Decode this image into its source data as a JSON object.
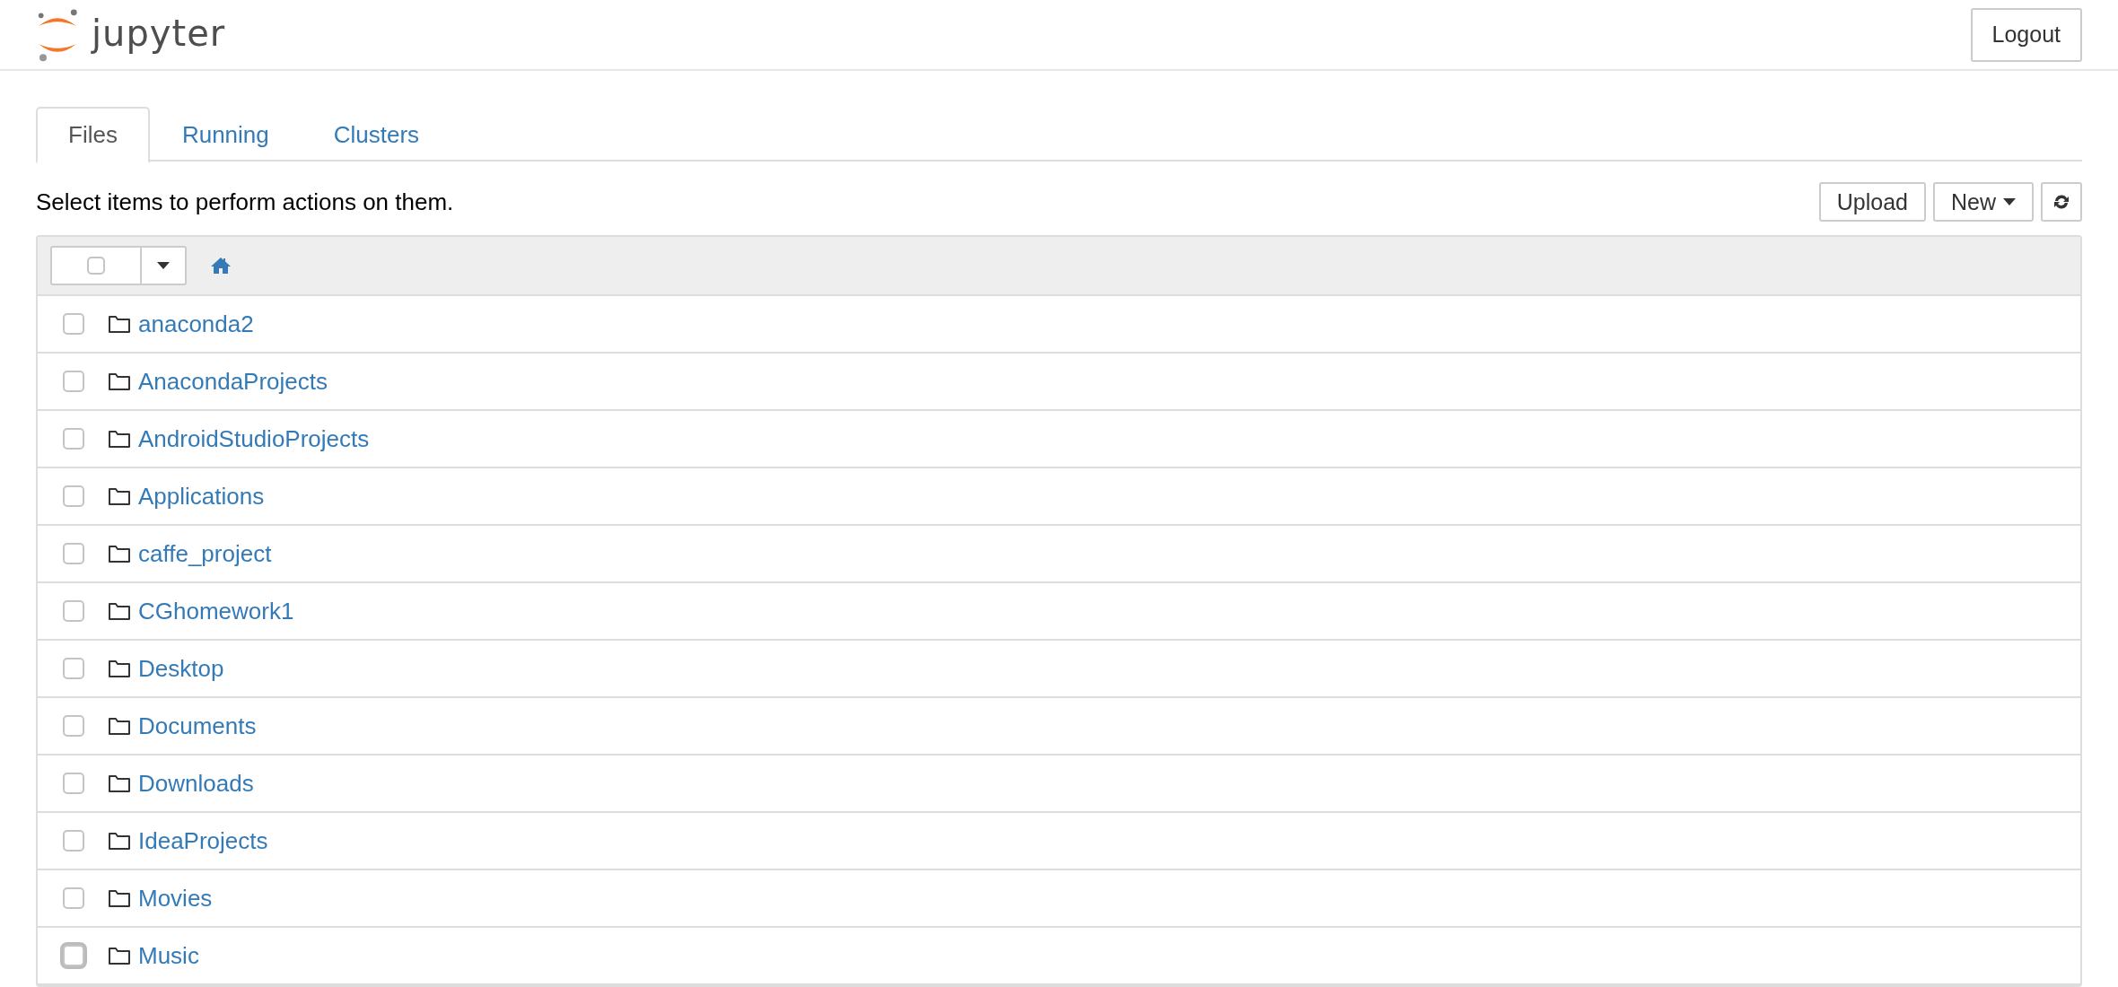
{
  "header": {
    "logo_text": "jupyter",
    "logout": "Logout"
  },
  "tabs": [
    {
      "label": "Files",
      "selected": true
    },
    {
      "label": "Running",
      "selected": false
    },
    {
      "label": "Clusters",
      "selected": false
    }
  ],
  "hint": "Select items to perform actions on them.",
  "actions": {
    "upload": "Upload",
    "new": "New"
  },
  "select_all": {
    "checked": false
  },
  "items": [
    {
      "name": "anaconda2",
      "kind": "folder",
      "checked": false,
      "focused": false
    },
    {
      "name": "AnacondaProjects",
      "kind": "folder",
      "checked": false,
      "focused": false
    },
    {
      "name": "AndroidStudioProjects",
      "kind": "folder",
      "checked": false,
      "focused": false
    },
    {
      "name": "Applications",
      "kind": "folder",
      "checked": false,
      "focused": false
    },
    {
      "name": "caffe_project",
      "kind": "folder",
      "checked": false,
      "focused": false
    },
    {
      "name": "CGhomework1",
      "kind": "folder",
      "checked": false,
      "focused": false
    },
    {
      "name": "Desktop",
      "kind": "folder",
      "checked": false,
      "focused": false
    },
    {
      "name": "Documents",
      "kind": "folder",
      "checked": false,
      "focused": false
    },
    {
      "name": "Downloads",
      "kind": "folder",
      "checked": false,
      "focused": false
    },
    {
      "name": "IdeaProjects",
      "kind": "folder",
      "checked": false,
      "focused": false
    },
    {
      "name": "Movies",
      "kind": "folder",
      "checked": false,
      "focused": false
    },
    {
      "name": "Music",
      "kind": "folder",
      "checked": false,
      "focused": true
    }
  ]
}
